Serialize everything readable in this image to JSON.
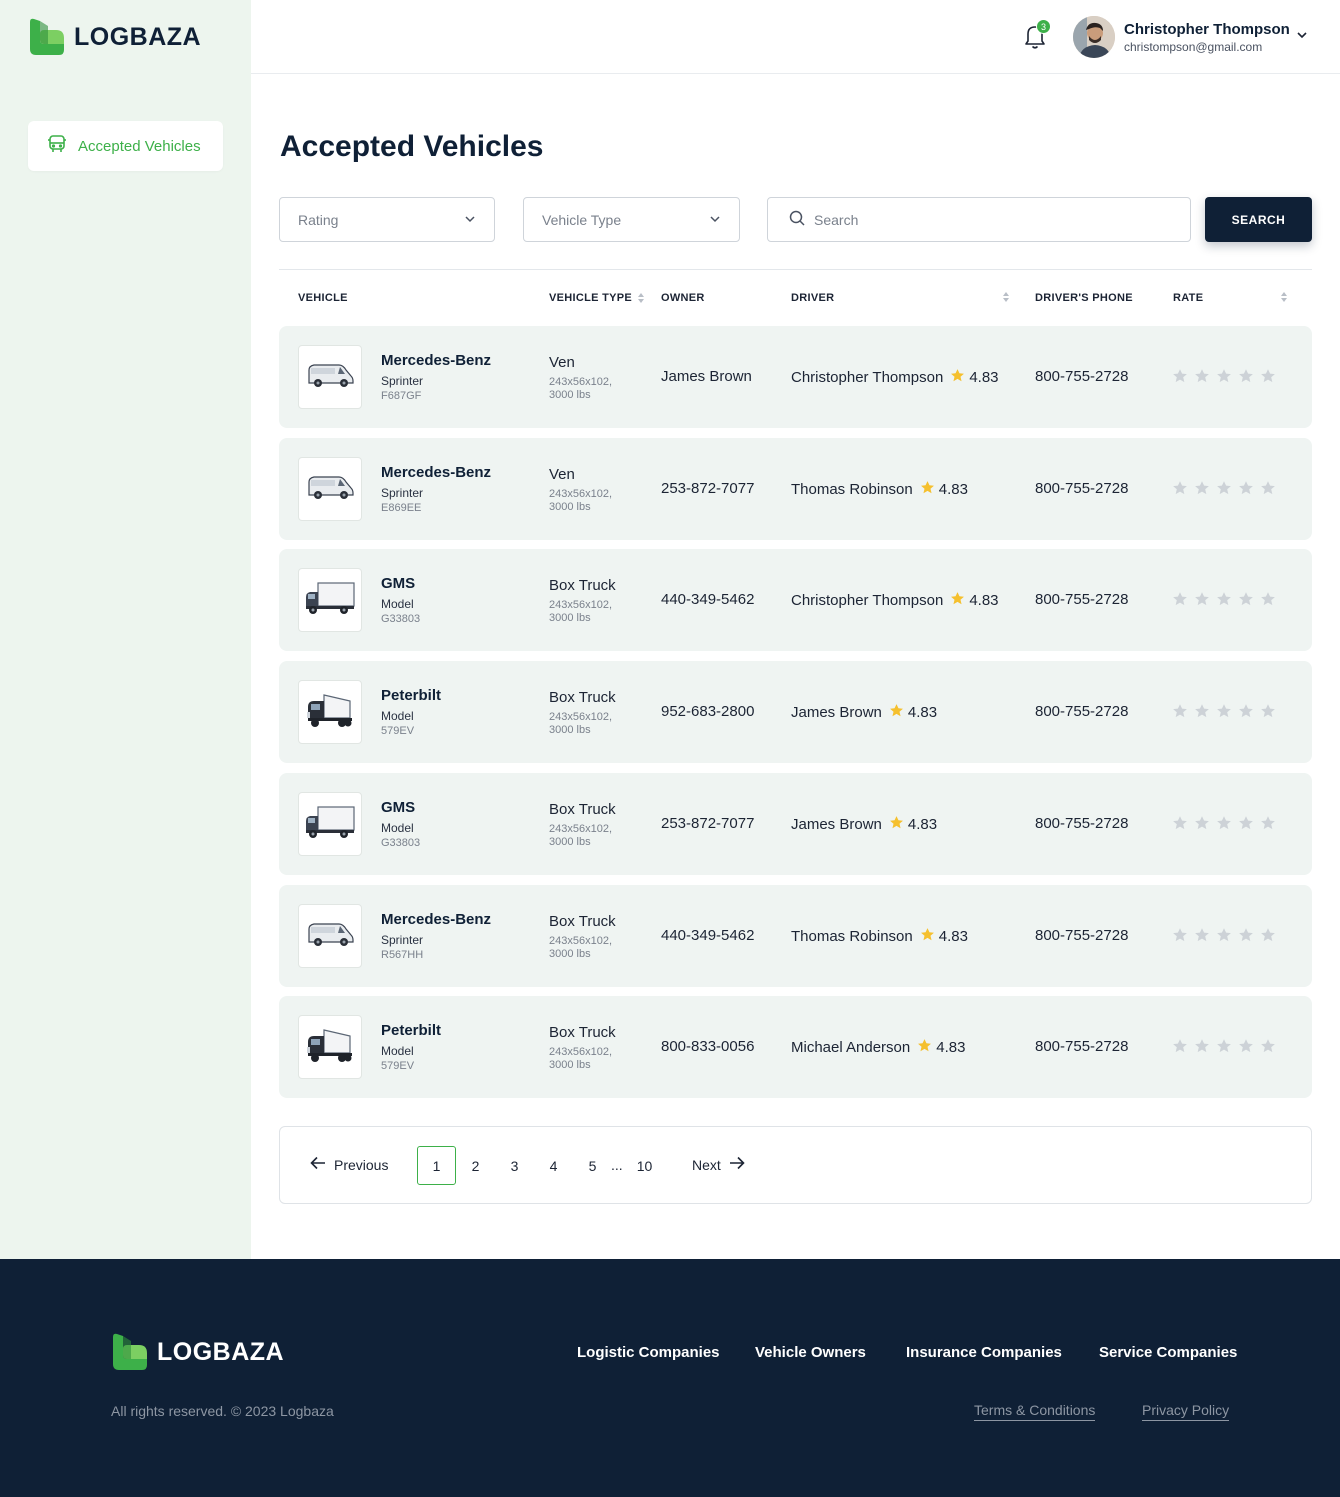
{
  "brand": {
    "name": "LOGBAZA",
    "accent": "#3db049",
    "dark": "#0f2036"
  },
  "sidebar": {
    "items": [
      {
        "label": "Accepted Vehicles",
        "icon": "bus-icon",
        "active": true
      }
    ]
  },
  "header": {
    "notifications": "3",
    "user": {
      "name": "Christopher Thompson",
      "email": "christompson@gmail.com"
    }
  },
  "main": {
    "title": "Accepted Vehicles",
    "filters": {
      "rating_placeholder": "Rating",
      "vehicle_type_placeholder": "Vehicle Type",
      "search_placeholder": "Search",
      "search_button": "SEARCH"
    },
    "columns": {
      "vehicle": "VEHICLE",
      "vehicle_type": "VEHICLE TYPE",
      "owner": "OWNER",
      "driver": "DRIVER",
      "phone": "DRIVER'S PHONE",
      "rate": "RATE"
    },
    "rows": [
      {
        "make": "Mercedes-Benz",
        "model": "Sprinter",
        "code": "F687GF",
        "type": "Ven",
        "dim1": "243x56x102,",
        "dim2": "3000 lbs",
        "owner": "James Brown",
        "driver": "Christopher Thompson",
        "rating": "4.83",
        "phone": "800-755-2728",
        "vehicle_icon": "van-icon",
        "rate_stars": 0
      },
      {
        "make": "Mercedes-Benz",
        "model": "Sprinter",
        "code": "E869EE",
        "type": "Ven",
        "dim1": "243x56x102,",
        "dim2": "3000 lbs",
        "owner": "253-872-7077",
        "driver": "Thomas Robinson",
        "rating": "4.83",
        "phone": "800-755-2728",
        "vehicle_icon": "van-icon",
        "rate_stars": 0
      },
      {
        "make": "GMS",
        "model": "Model",
        "code": "G33803",
        "type": "Box Truck",
        "dim1": "243x56x102,",
        "dim2": "3000 lbs",
        "owner": "440-349-5462",
        "driver": "Christopher Thompson",
        "rating": "4.83",
        "phone": "800-755-2728",
        "vehicle_icon": "box-truck-icon",
        "rate_stars": 0
      },
      {
        "make": "Peterbilt",
        "model": "Model",
        "code": "579EV",
        "type": "Box Truck",
        "dim1": "243x56x102,",
        "dim2": "3000 lbs",
        "owner": "952-683-2800",
        "driver": "James Brown",
        "rating": "4.83",
        "phone": "800-755-2728",
        "vehicle_icon": "semi-truck-icon",
        "rate_stars": 0
      },
      {
        "make": "GMS",
        "model": "Model",
        "code": "G33803",
        "type": "Box Truck",
        "dim1": "243x56x102,",
        "dim2": "3000 lbs",
        "owner": "253-872-7077",
        "driver": "James Brown",
        "rating": "4.83",
        "phone": "800-755-2728",
        "vehicle_icon": "box-truck-icon",
        "rate_stars": 0
      },
      {
        "make": "Mercedes-Benz",
        "model": "Sprinter",
        "code": "R567HH",
        "type": "Box Truck",
        "dim1": "243x56x102,",
        "dim2": "3000 lbs",
        "owner": "440-349-5462",
        "driver": "Thomas Robinson",
        "rating": "4.83",
        "phone": "800-755-2728",
        "vehicle_icon": "van-icon",
        "rate_stars": 0
      },
      {
        "make": "Peterbilt",
        "model": "Model",
        "code": "579EV",
        "type": "Box Truck",
        "dim1": "243x56x102,",
        "dim2": "3000 lbs",
        "owner": "800-833-0056",
        "driver": "Michael Anderson",
        "rating": "4.83",
        "phone": "800-755-2728",
        "vehicle_icon": "semi-truck-icon",
        "rate_stars": 0
      }
    ],
    "pagination": {
      "previous": "Previous",
      "next": "Next",
      "pages": [
        "1",
        "2",
        "3",
        "4",
        "5"
      ],
      "ellipsis": "...",
      "last": "10",
      "current": "1"
    }
  },
  "footer": {
    "links": [
      "Logistic Companies",
      "Vehicle Owners",
      "Insurance Companies",
      "Service Companies"
    ],
    "copyright": "All rights reserved. © 2023 Logbaza",
    "legal": [
      "Terms & Conditions",
      "Privacy Policy"
    ]
  }
}
